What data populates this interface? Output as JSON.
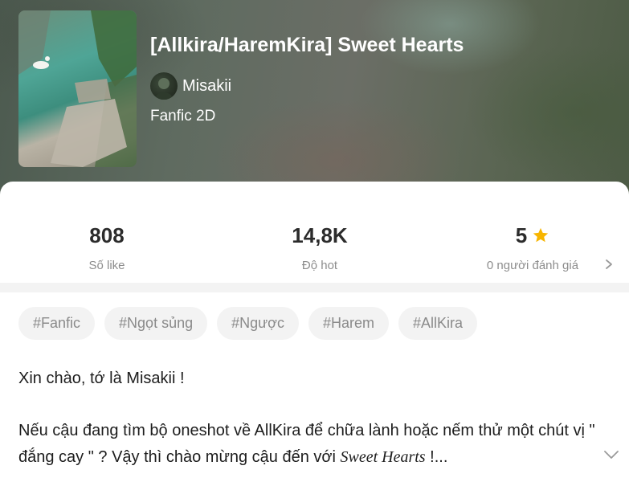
{
  "story": {
    "title": "[Allkira/HaremKira] Sweet Hearts",
    "author": "Misakii",
    "genre": "Fanfic 2D"
  },
  "stats": {
    "likes_value": "808",
    "likes_label": "Số like",
    "hot_value": "14,8K",
    "hot_label": "Độ hot",
    "rating_value": "5",
    "rating_label": "0 người đánh giá",
    "rating_icon": "star-icon",
    "rating_icon_color": "#f7b500"
  },
  "tags": [
    "#Fanfic",
    "#Ngọt sủng",
    "#Ngược",
    "#Harem",
    "#AllKira"
  ],
  "description": {
    "line1": "Xin chào, tớ là Misakii !",
    "para2_part1": "Nếu cậu đang tìm bộ oneshot về AllKira để chữa lành hoặc nếm thử một chút vị \" đắng cay \" ? Vậy thì chào mừng cậu đến với ",
    "para2_emphasis": "Sweet Hearts",
    "para2_part2": " !..."
  },
  "icons": {
    "details_chevron": "chevron-right-icon",
    "expand_chevron": "chevron-down-icon"
  }
}
